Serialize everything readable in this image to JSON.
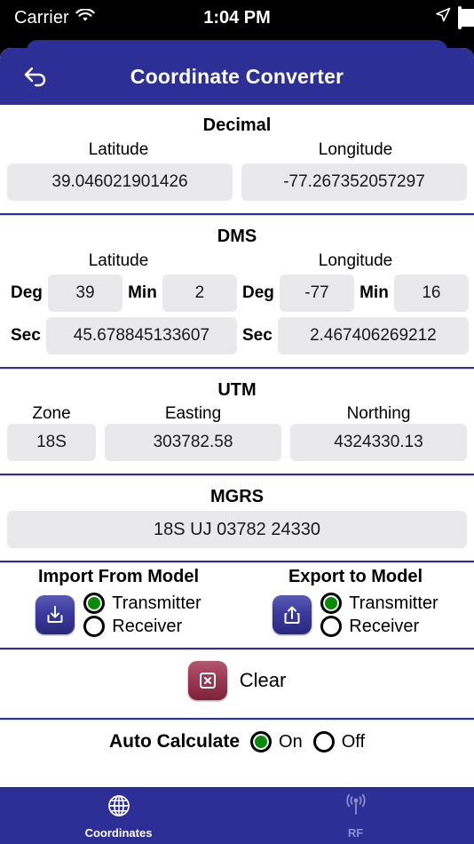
{
  "status_bar": {
    "carrier": "Carrier",
    "wifi_icon": "wifi-icon",
    "time": "1:04 PM",
    "location_icon": "location-arrow-icon",
    "battery_icon": "battery-icon"
  },
  "nav": {
    "back_icon": "back-arrow-icon",
    "title": "Coordinate Converter"
  },
  "decimal": {
    "title": "Decimal",
    "latitude_label": "Latitude",
    "longitude_label": "Longitude",
    "latitude_value": "39.046021901426",
    "longitude_value": "-77.267352057297"
  },
  "dms": {
    "title": "DMS",
    "latitude_label": "Latitude",
    "longitude_label": "Longitude",
    "lat_deg_label": "Deg",
    "lat_deg_value": "39",
    "lat_min_label": "Min",
    "lat_min_value": "2",
    "lat_sec_label": "Sec",
    "lat_sec_value": "45.678845133607",
    "lon_deg_label": "Deg",
    "lon_deg_value": "-77",
    "lon_min_label": "Min",
    "lon_min_value": "16",
    "lon_sec_label": "Sec",
    "lon_sec_value": "2.467406269212"
  },
  "utm": {
    "title": "UTM",
    "zone_label": "Zone",
    "easting_label": "Easting",
    "northing_label": "Northing",
    "zone_value": "18S",
    "easting_value": "303782.58",
    "northing_value": "4324330.13"
  },
  "mgrs": {
    "title": "MGRS",
    "value": "18S UJ 03782 24330"
  },
  "import": {
    "title": "Import From Model",
    "button_icon": "import-download-icon",
    "options": [
      {
        "label": "Transmitter",
        "selected": true
      },
      {
        "label": "Receiver",
        "selected": false
      }
    ]
  },
  "export": {
    "title": "Export to Model",
    "button_icon": "export-share-icon",
    "options": [
      {
        "label": "Transmitter",
        "selected": true
      },
      {
        "label": "Receiver",
        "selected": false
      }
    ]
  },
  "clear": {
    "icon": "x-square-icon",
    "label": "Clear"
  },
  "auto_calculate": {
    "label": "Auto Calculate",
    "options": [
      {
        "label": "On",
        "selected": true
      },
      {
        "label": "Off",
        "selected": false
      }
    ]
  },
  "tabbar": {
    "tabs": [
      {
        "label": "Coordinates",
        "icon": "globe-icon",
        "active": true
      },
      {
        "label": "RF",
        "icon": "antenna-icon",
        "active": false
      }
    ]
  },
  "colors": {
    "brand": "#2d2f97",
    "field_bg": "#e9e9eb",
    "radio_on": "#0a8a0a",
    "clear_red": "#9c3a54",
    "tab_inactive": "#8d8fc6"
  }
}
